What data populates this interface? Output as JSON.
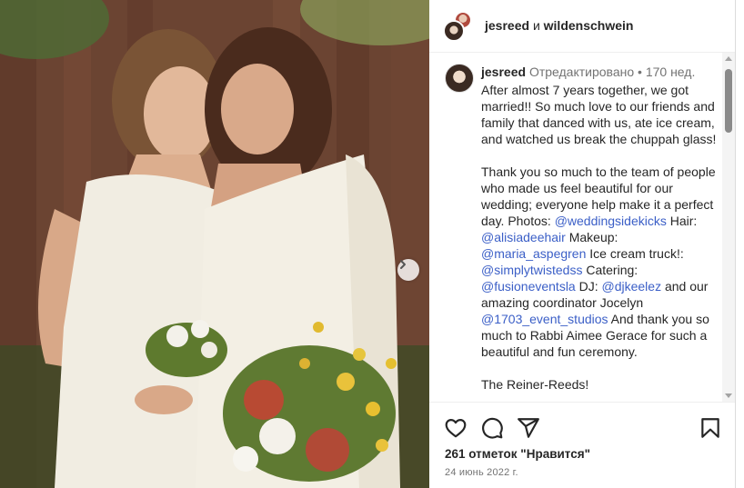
{
  "post": {
    "header": {
      "author": "jesreed",
      "conjunction": "и",
      "coauthor": "wildenschwein"
    },
    "caption": {
      "author": "jesreed",
      "edited_label": "Отредактировано",
      "separator": "•",
      "age": "170 нед.",
      "paragraph1": "After almost 7 years together, we got married!! So much love to our friends and family that danced with us, ate ice cream, and watched us break the chuppah glass!",
      "p2_intro": "Thank you so much to the team of people who made us feel beautiful for our wedding; everyone help make it a perfect day.  Photos: ",
      "p2_mention_photos": "@weddingsidekicks",
      "p2_hair_label": " Hair: ",
      "p2_mention_hair": "@alisiadeehair",
      "p2_makeup_label": " Makeup:  ",
      "p2_mention_makeup": "@maria_aspegren",
      "p2_icecream_label": " Ice cream truck!: ",
      "p2_mention_icecream": "@simplytwistedss",
      "p2_catering_label": " Catering: ",
      "p2_mention_catering": "@fusioneventsla",
      "p2_dj_label": " DJ: ",
      "p2_mention_dj": "@djkeelez",
      "p2_coordinator_label": " and our amazing coordinator Jocelyn ",
      "p2_mention_coordinator": "@1703_event_studios",
      "p2_outro": " And thank you so much to Rabbi Aimee Gerace for such a beautiful and fun ceremony.",
      "signoff": "The Reiner-Reeds!"
    },
    "actions": {
      "like": "heart-icon",
      "comment": "comment-icon",
      "share": "send-icon",
      "save": "bookmark-icon"
    },
    "likes_text": "261 отметок \"Нравится\"",
    "date": "24 июнь 2022 г."
  },
  "colors": {
    "mention": "#3b5fc7",
    "meta_gray": "#737373",
    "border": "#efefef"
  }
}
